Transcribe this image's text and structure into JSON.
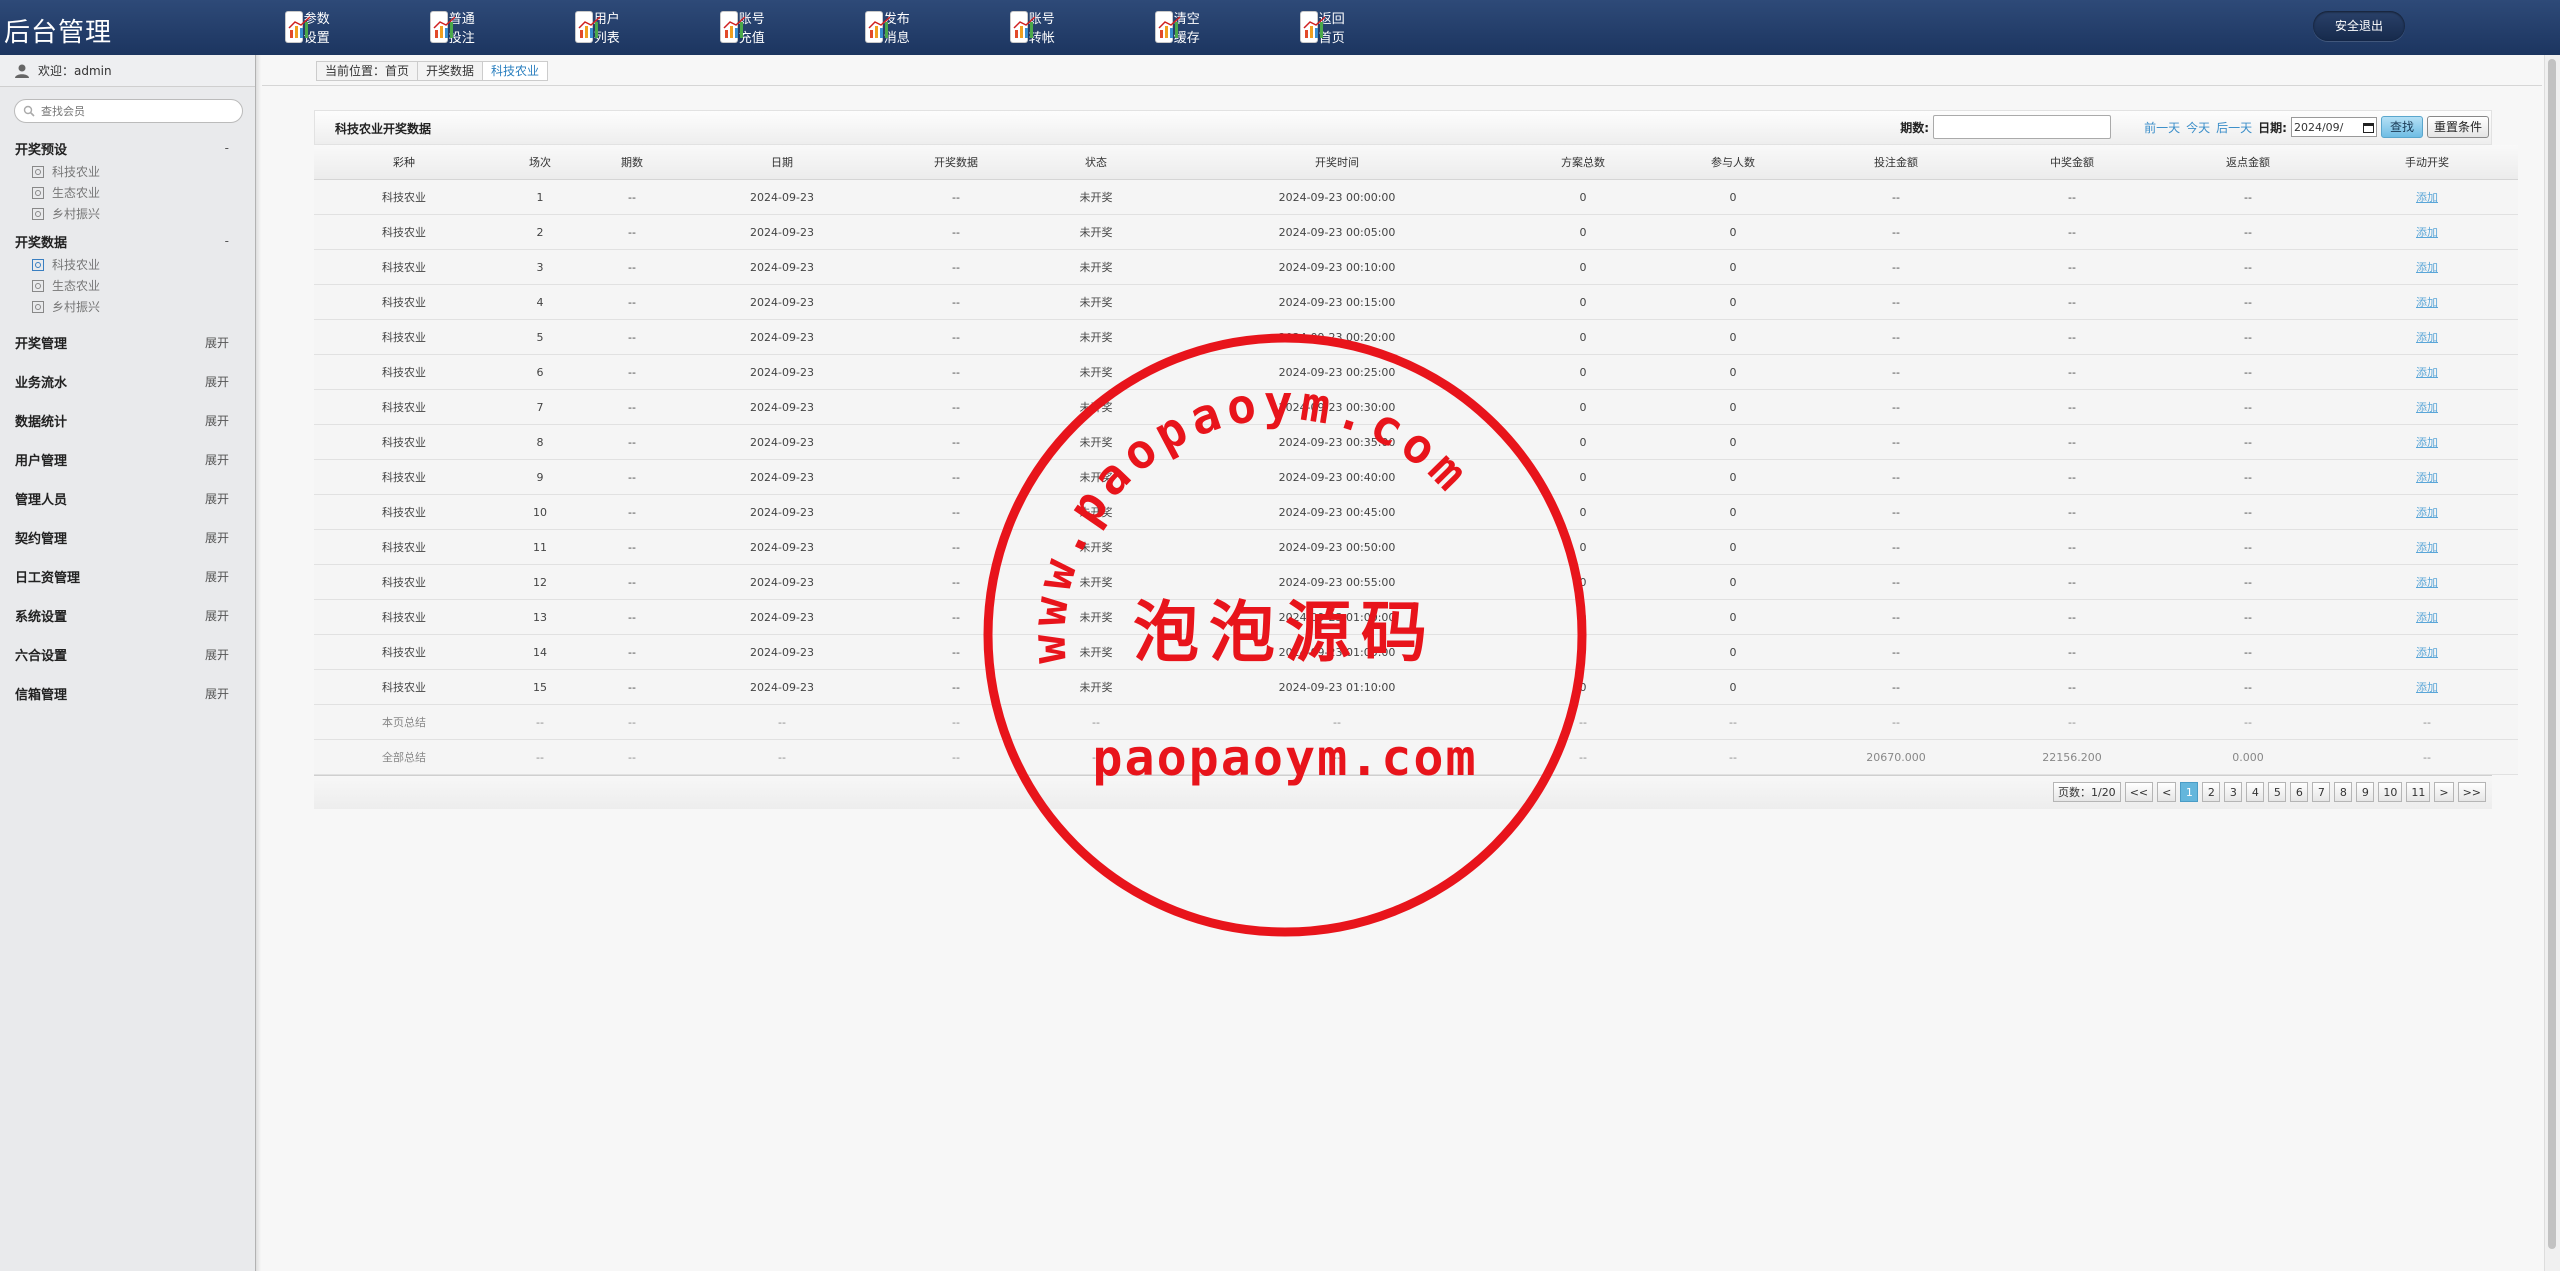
{
  "app": {
    "title": "后台管理",
    "logout_label": "安全退出"
  },
  "topnav": [
    {
      "label": "参数设置",
      "icon": "chart-icon"
    },
    {
      "label": "普通投注",
      "icon": "chart-icon"
    },
    {
      "label": "用户列表",
      "icon": "chart-icon"
    },
    {
      "label": "账号充值",
      "icon": "chart-icon"
    },
    {
      "label": "发布消息",
      "icon": "chart-icon"
    },
    {
      "label": "账号转帐",
      "icon": "chart-icon"
    },
    {
      "label": "清空缓存",
      "icon": "chart-icon"
    },
    {
      "label": "返回首页",
      "icon": "chart-icon"
    }
  ],
  "sidebar": {
    "welcome": "欢迎：admin",
    "search_placeholder": "查找会员",
    "groups": [
      {
        "label": "开奖预设",
        "toggle": "-",
        "items": [
          "科技农业",
          "生态农业",
          "乡村振兴"
        ]
      },
      {
        "label": "开奖数据",
        "toggle": "-",
        "items": [
          "科技农业",
          "生态农业",
          "乡村振兴"
        ],
        "active_index": 0
      }
    ],
    "collapsed": [
      {
        "label": "开奖管理",
        "toggle": "展开"
      },
      {
        "label": "业务流水",
        "toggle": "展开"
      },
      {
        "label": "数据统计",
        "toggle": "展开"
      },
      {
        "label": "用户管理",
        "toggle": "展开"
      },
      {
        "label": "管理人员",
        "toggle": "展开"
      },
      {
        "label": "契约管理",
        "toggle": "展开"
      },
      {
        "label": "日工资管理",
        "toggle": "展开"
      },
      {
        "label": "系统设置",
        "toggle": "展开"
      },
      {
        "label": "六合设置",
        "toggle": "展开"
      },
      {
        "label": "信箱管理",
        "toggle": "展开"
      }
    ]
  },
  "breadcrumb": [
    "当前位置：首页",
    "开奖数据",
    "科技农业"
  ],
  "panel": {
    "title": "科技农业开奖数据",
    "period_label": "期数:",
    "prev_day": "前一天",
    "today": "今天",
    "next_day": "后一天",
    "date_label": "日期:",
    "date_value": "2024/09/",
    "search_label": "查找",
    "reset_label": "重置条件"
  },
  "table": {
    "columns": [
      "彩种",
      "场次",
      "期数",
      "日期",
      "开奖数据",
      "状态",
      "开奖时间",
      "方案总数",
      "参与人数",
      "投注金额",
      "中奖金额",
      "返点金额",
      "手动开奖"
    ],
    "rows": [
      [
        "科技农业",
        "1",
        "--",
        "2024-09-23",
        "--",
        "未开奖",
        "2024-09-23 00:00:00",
        "0",
        "0",
        "--",
        "--",
        "--",
        "添加"
      ],
      [
        "科技农业",
        "2",
        "--",
        "2024-09-23",
        "--",
        "未开奖",
        "2024-09-23 00:05:00",
        "0",
        "0",
        "--",
        "--",
        "--",
        "添加"
      ],
      [
        "科技农业",
        "3",
        "--",
        "2024-09-23",
        "--",
        "未开奖",
        "2024-09-23 00:10:00",
        "0",
        "0",
        "--",
        "--",
        "--",
        "添加"
      ],
      [
        "科技农业",
        "4",
        "--",
        "2024-09-23",
        "--",
        "未开奖",
        "2024-09-23 00:15:00",
        "0",
        "0",
        "--",
        "--",
        "--",
        "添加"
      ],
      [
        "科技农业",
        "5",
        "--",
        "2024-09-23",
        "--",
        "未开奖",
        "2024-09-23 00:20:00",
        "0",
        "0",
        "--",
        "--",
        "--",
        "添加"
      ],
      [
        "科技农业",
        "6",
        "--",
        "2024-09-23",
        "--",
        "未开奖",
        "2024-09-23 00:25:00",
        "0",
        "0",
        "--",
        "--",
        "--",
        "添加"
      ],
      [
        "科技农业",
        "7",
        "--",
        "2024-09-23",
        "--",
        "未开奖",
        "2024-09-23 00:30:00",
        "0",
        "0",
        "--",
        "--",
        "--",
        "添加"
      ],
      [
        "科技农业",
        "8",
        "--",
        "2024-09-23",
        "--",
        "未开奖",
        "2024-09-23 00:35:00",
        "0",
        "0",
        "--",
        "--",
        "--",
        "添加"
      ],
      [
        "科技农业",
        "9",
        "--",
        "2024-09-23",
        "--",
        "未开奖",
        "2024-09-23 00:40:00",
        "0",
        "0",
        "--",
        "--",
        "--",
        "添加"
      ],
      [
        "科技农业",
        "10",
        "--",
        "2024-09-23",
        "--",
        "未开奖",
        "2024-09-23 00:45:00",
        "0",
        "0",
        "--",
        "--",
        "--",
        "添加"
      ],
      [
        "科技农业",
        "11",
        "--",
        "2024-09-23",
        "--",
        "未开奖",
        "2024-09-23 00:50:00",
        "0",
        "0",
        "--",
        "--",
        "--",
        "添加"
      ],
      [
        "科技农业",
        "12",
        "--",
        "2024-09-23",
        "--",
        "未开奖",
        "2024-09-23 00:55:00",
        "0",
        "0",
        "--",
        "--",
        "--",
        "添加"
      ],
      [
        "科技农业",
        "13",
        "--",
        "2024-09-23",
        "--",
        "未开奖",
        "2024-09-23 01:00:00",
        "0",
        "0",
        "--",
        "--",
        "--",
        "添加"
      ],
      [
        "科技农业",
        "14",
        "--",
        "2024-09-23",
        "--",
        "未开奖",
        "2024-09-23 01:05:00",
        "0",
        "0",
        "--",
        "--",
        "--",
        "添加"
      ],
      [
        "科技农业",
        "15",
        "--",
        "2024-09-23",
        "--",
        "未开奖",
        "2024-09-23 01:10:00",
        "0",
        "0",
        "--",
        "--",
        "--",
        "添加"
      ]
    ],
    "summary": [
      [
        "本页总结",
        "--",
        "--",
        "--",
        "--",
        "--",
        "--",
        "--",
        "--",
        "--",
        "--",
        "--",
        "--"
      ],
      [
        "全部总结",
        "--",
        "--",
        "--",
        "--",
        "--",
        "--",
        "--",
        "--",
        "20670.000",
        "22156.200",
        "0.000",
        "--"
      ]
    ]
  },
  "pager": {
    "info": "页数：1/20",
    "first": "<<",
    "prev": "<",
    "pages": [
      "1",
      "2",
      "3",
      "4",
      "5",
      "6",
      "7",
      "8",
      "9",
      "10",
      "11"
    ],
    "current": "1",
    "next": ">",
    "last": ">>"
  },
  "watermark": {
    "arc_text": "www.paopaoym.com",
    "center_text": "泡泡源码",
    "bottom_text": "paopaoym.com",
    "color": "#e8141b"
  },
  "colors": {
    "topbar": "#23406c",
    "link": "#3b8ec9",
    "current_page": "#64b6dc"
  }
}
